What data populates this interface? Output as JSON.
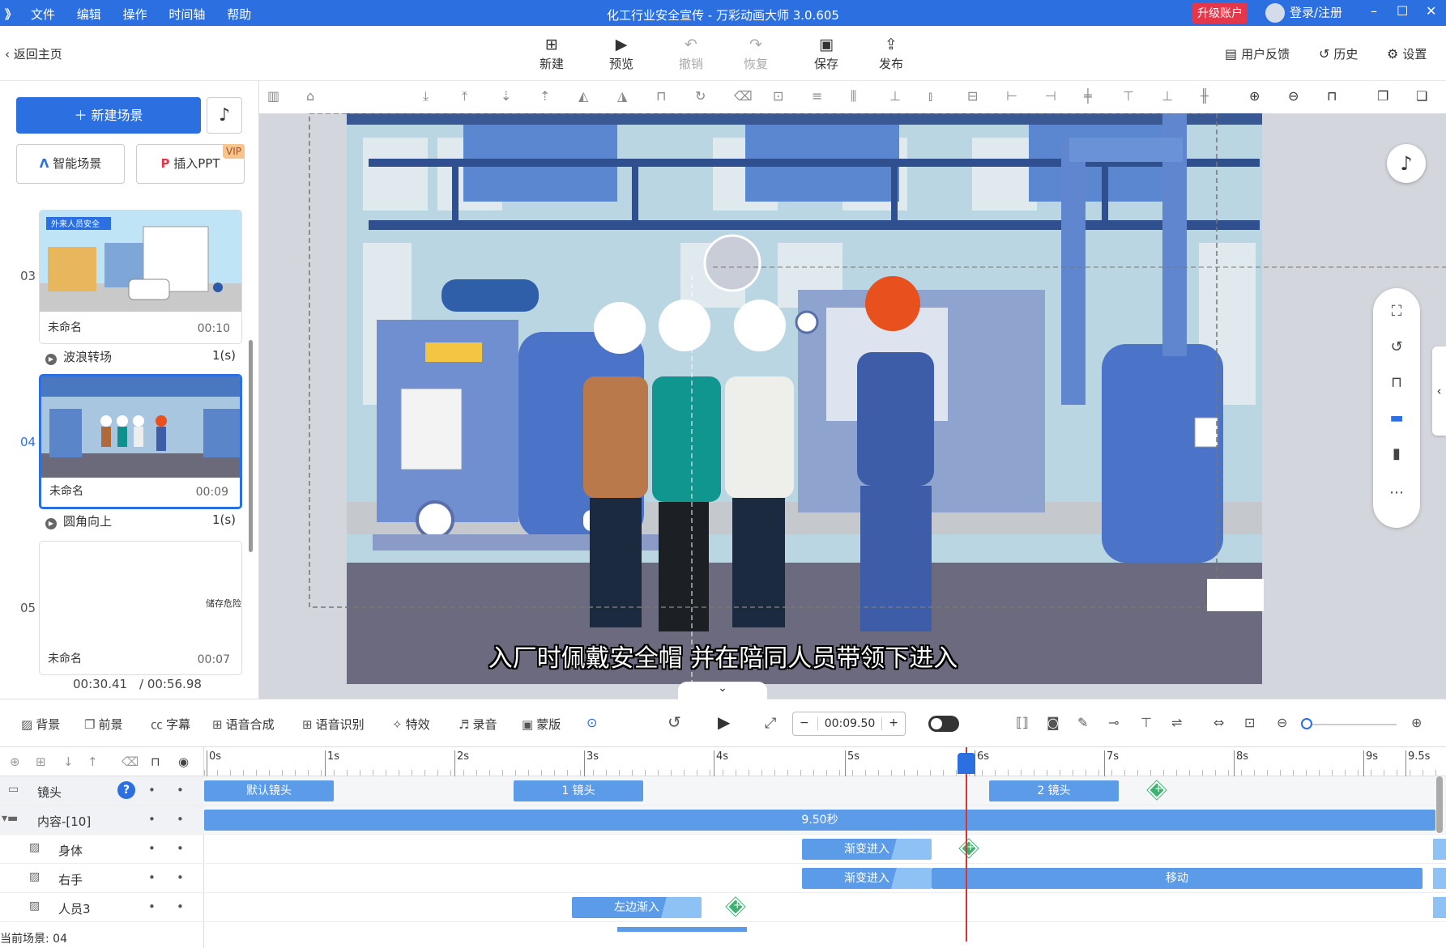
{
  "titlebar": {
    "logo": "》",
    "menu": [
      "文件",
      "编辑",
      "操作",
      "时间轴",
      "帮助"
    ],
    "title": "化工行业安全宣传 - 万彩动画大师 3.0.605",
    "upgrade": "升级账户",
    "login": "登录/注册",
    "controls": [
      "–",
      "☐",
      "✕"
    ]
  },
  "toolbar": {
    "back": "返回主页",
    "buttons": [
      {
        "label": "新建",
        "icon": "plus-square"
      },
      {
        "label": "预览",
        "icon": "play"
      },
      {
        "label": "撤销",
        "icon": "undo"
      },
      {
        "label": "恢复",
        "icon": "redo"
      },
      {
        "label": "保存",
        "icon": "save"
      },
      {
        "label": "发布",
        "icon": "publish"
      }
    ],
    "feedback": "用户反馈",
    "history": "历史",
    "settings": "设置"
  },
  "left": {
    "new_scene": "新建场景",
    "smart_scene": "智能场景",
    "insert_ppt": "插入PPT",
    "vip": "VIP",
    "scenes": [
      {
        "num": "03",
        "name": "未命名",
        "dur": "00:10",
        "thumb_title": "外来人员安全"
      },
      {
        "num": "04",
        "name": "未命名",
        "dur": "00:09"
      },
      {
        "num": "05",
        "name": "未命名",
        "dur": "00:07",
        "thumb_text": "储存危险"
      }
    ],
    "transitions": [
      {
        "name": "波浪转场",
        "time": "1(s)"
      },
      {
        "name": "圆角向上",
        "time": "1(s)"
      }
    ],
    "current_time": "00:30.41",
    "total_time": "/ 00:56.98"
  },
  "canvas": {
    "subtitle": "入厂时佩戴安全帽 并在陪同人员带领下进入"
  },
  "tl_toolbar": {
    "items": [
      "背景",
      "前景",
      "字幕",
      "语音合成",
      "语音识别",
      "特效",
      "录音",
      "蒙版"
    ],
    "time": "00:09.50",
    "minus": "−",
    "plus": "+"
  },
  "timeline": {
    "ticks": [
      "0s",
      "1s",
      "2s",
      "3s",
      "4s",
      "5s",
      "6s",
      "7s",
      "8s",
      "9s",
      "9.5s"
    ],
    "rows": [
      {
        "label": "镜头"
      },
      {
        "label": "内容-[10]"
      },
      {
        "label": "身体"
      },
      {
        "label": "右手"
      },
      {
        "label": "人员3"
      }
    ],
    "clips": {
      "cam_default": "默认镜头",
      "cam1": "1 镜头",
      "cam2": "2 镜头",
      "content": "9.50秒",
      "body": "渐变进入",
      "hand_in": "渐变进入",
      "hand_move": "移动",
      "person3": "左边渐入"
    },
    "current_scene": "当前场景: 04"
  }
}
